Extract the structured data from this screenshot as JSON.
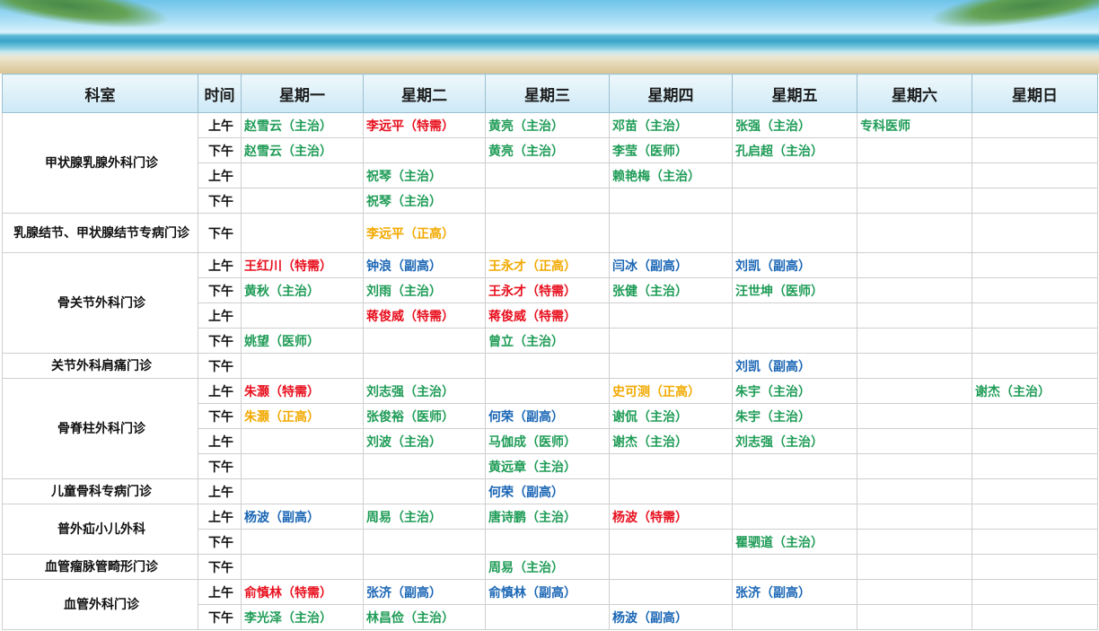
{
  "colors": {
    "green": "#1f9c57",
    "red": "#e8101e",
    "blue": "#1a66b5",
    "gold": "#f2a900"
  },
  "header": [
    "科室",
    "时间",
    "星期一",
    "星期二",
    "星期三",
    "星期四",
    "星期五",
    "星期六",
    "星期日"
  ],
  "departments": [
    {
      "name": "甲状腺乳腺外科门诊",
      "rows": [
        {
          "time": "上午",
          "cells": [
            [
              "赵雪云（主治）",
              "green"
            ],
            [
              "李远平（特需）",
              "red"
            ],
            [
              "黄亮（主治）",
              "green"
            ],
            [
              "邓苗（主治）",
              "green"
            ],
            [
              "张强（主治）",
              "green"
            ],
            [
              "专科医师",
              "green"
            ],
            [
              "",
              ""
            ]
          ]
        },
        {
          "time": "下午",
          "cells": [
            [
              "赵雪云（主治）",
              "green"
            ],
            [
              "",
              ""
            ],
            [
              "黄亮（主治）",
              "green"
            ],
            [
              "李莹（医师）",
              "green"
            ],
            [
              "孔启超（主治）",
              "green"
            ],
            [
              "",
              ""
            ],
            [
              "",
              ""
            ]
          ]
        },
        {
          "time": "上午",
          "cells": [
            [
              "",
              ""
            ],
            [
              "祝琴（主治）",
              "green"
            ],
            [
              "",
              ""
            ],
            [
              "赖艳梅（主治）",
              "green"
            ],
            [
              "",
              ""
            ],
            [
              "",
              ""
            ],
            [
              "",
              ""
            ]
          ]
        },
        {
          "time": "下午",
          "cells": [
            [
              "",
              ""
            ],
            [
              "祝琴（主治）",
              "green"
            ],
            [
              "",
              ""
            ],
            [
              "",
              ""
            ],
            [
              "",
              ""
            ],
            [
              "",
              ""
            ],
            [
              "",
              ""
            ]
          ]
        }
      ]
    },
    {
      "name": "乳腺结节、甲状腺结节专病门诊",
      "tall": true,
      "rows": [
        {
          "time": "下午",
          "cells": [
            [
              "",
              ""
            ],
            [
              "李远平（正高）",
              "gold"
            ],
            [
              "",
              ""
            ],
            [
              "",
              ""
            ],
            [
              "",
              ""
            ],
            [
              "",
              ""
            ],
            [
              "",
              ""
            ]
          ]
        }
      ]
    },
    {
      "name": "骨关节外科门诊",
      "rows": [
        {
          "time": "上午",
          "cells": [
            [
              "王红川（特需）",
              "red"
            ],
            [
              "钟浪（副高）",
              "blue"
            ],
            [
              "王永才（正高）",
              "gold"
            ],
            [
              "闫冰（副高）",
              "blue"
            ],
            [
              "刘凯（副高）",
              "blue"
            ],
            [
              "",
              ""
            ],
            [
              "",
              ""
            ]
          ]
        },
        {
          "time": "下午",
          "cells": [
            [
              "黄秋（主治）",
              "green"
            ],
            [
              "刘雨（主治）",
              "green"
            ],
            [
              "王永才（特需）",
              "red"
            ],
            [
              "张健（主治）",
              "green"
            ],
            [
              "汪世坤（医师）",
              "green"
            ],
            [
              "",
              ""
            ],
            [
              "",
              ""
            ]
          ]
        },
        {
          "time": "上午",
          "cells": [
            [
              "",
              ""
            ],
            [
              "蒋俊威（特需）",
              "red"
            ],
            [
              "蒋俊威（特需）",
              "red"
            ],
            [
              "",
              ""
            ],
            [
              "",
              ""
            ],
            [
              "",
              ""
            ],
            [
              "",
              ""
            ]
          ]
        },
        {
          "time": "下午",
          "cells": [
            [
              "姚望（医师）",
              "green"
            ],
            [
              "",
              ""
            ],
            [
              "曾立（主治）",
              "green"
            ],
            [
              "",
              ""
            ],
            [
              "",
              ""
            ],
            [
              "",
              ""
            ],
            [
              "",
              ""
            ]
          ]
        }
      ]
    },
    {
      "name": "关节外科肩痛门诊",
      "rows": [
        {
          "time": "下午",
          "cells": [
            [
              "",
              ""
            ],
            [
              "",
              ""
            ],
            [
              "",
              ""
            ],
            [
              "",
              ""
            ],
            [
              "刘凯（副高）",
              "blue"
            ],
            [
              "",
              ""
            ],
            [
              "",
              ""
            ]
          ]
        }
      ]
    },
    {
      "name": "骨脊柱外科门诊",
      "rows": [
        {
          "time": "上午",
          "cells": [
            [
              "朱灏（特需）",
              "red"
            ],
            [
              "刘志强（主治）",
              "green"
            ],
            [
              "",
              ""
            ],
            [
              "史可测（正高）",
              "gold"
            ],
            [
              "朱宇（主治）",
              "green"
            ],
            [
              "",
              ""
            ],
            [
              "谢杰（主治）",
              "green"
            ]
          ]
        },
        {
          "time": "下午",
          "cells": [
            [
              "朱灏（正高）",
              "gold"
            ],
            [
              "张俊裕（医师）",
              "green"
            ],
            [
              "何荣（副高）",
              "blue"
            ],
            [
              "谢侃（主治）",
              "green"
            ],
            [
              "朱宇（主治）",
              "green"
            ],
            [
              "",
              ""
            ],
            [
              "",
              ""
            ]
          ]
        },
        {
          "time": "上午",
          "cells": [
            [
              "",
              ""
            ],
            [
              "刘波（主治）",
              "green"
            ],
            [
              "马伽成（医师）",
              "green"
            ],
            [
              "谢杰（主治）",
              "green"
            ],
            [
              "刘志强（主治）",
              "green"
            ],
            [
              "",
              ""
            ],
            [
              "",
              ""
            ]
          ]
        },
        {
          "time": "下午",
          "cells": [
            [
              "",
              ""
            ],
            [
              "",
              ""
            ],
            [
              "黄远章（主治）",
              "green"
            ],
            [
              "",
              ""
            ],
            [
              "",
              ""
            ],
            [
              "",
              ""
            ],
            [
              "",
              ""
            ]
          ]
        }
      ]
    },
    {
      "name": "儿童骨科专病门诊",
      "rows": [
        {
          "time": "上午",
          "cells": [
            [
              "",
              ""
            ],
            [
              "",
              ""
            ],
            [
              "何荣（副高）",
              "blue"
            ],
            [
              "",
              ""
            ],
            [
              "",
              ""
            ],
            [
              "",
              ""
            ],
            [
              "",
              ""
            ]
          ]
        }
      ]
    },
    {
      "name": "普外疝小儿外科",
      "rows": [
        {
          "time": "上午",
          "cells": [
            [
              "杨波（副高）",
              "blue"
            ],
            [
              "周易（主治）",
              "green"
            ],
            [
              "唐诗鹏（主治）",
              "green"
            ],
            [
              "杨波（特需）",
              "red"
            ],
            [
              "",
              ""
            ],
            [
              "",
              ""
            ],
            [
              "",
              ""
            ]
          ]
        },
        {
          "time": "下午",
          "cells": [
            [
              "",
              ""
            ],
            [
              "",
              ""
            ],
            [
              "",
              ""
            ],
            [
              "",
              ""
            ],
            [
              "瞿驷道（主治）",
              "green"
            ],
            [
              "",
              ""
            ],
            [
              "",
              ""
            ]
          ]
        }
      ]
    },
    {
      "name": "血管瘤脉管畸形门诊",
      "rows": [
        {
          "time": "下午",
          "cells": [
            [
              "",
              ""
            ],
            [
              "",
              ""
            ],
            [
              "周易（主治）",
              "green"
            ],
            [
              "",
              ""
            ],
            [
              "",
              ""
            ],
            [
              "",
              ""
            ],
            [
              "",
              ""
            ]
          ]
        }
      ]
    },
    {
      "name": "血管外科门诊",
      "rows": [
        {
          "time": "上午",
          "cells": [
            [
              "俞慎林（特需）",
              "red"
            ],
            [
              "张济（副高）",
              "blue"
            ],
            [
              "俞慎林（副高）",
              "blue"
            ],
            [
              "",
              ""
            ],
            [
              "张济（副高）",
              "blue"
            ],
            [
              "",
              ""
            ],
            [
              "",
              ""
            ]
          ]
        },
        {
          "time": "下午",
          "cells": [
            [
              "李光泽（主治）",
              "green"
            ],
            [
              "林昌俭（主治）",
              "green"
            ],
            [
              "",
              ""
            ],
            [
              "杨波（副高）",
              "blue"
            ],
            [
              "",
              ""
            ],
            [
              "",
              ""
            ],
            [
              "",
              ""
            ]
          ]
        }
      ]
    }
  ]
}
